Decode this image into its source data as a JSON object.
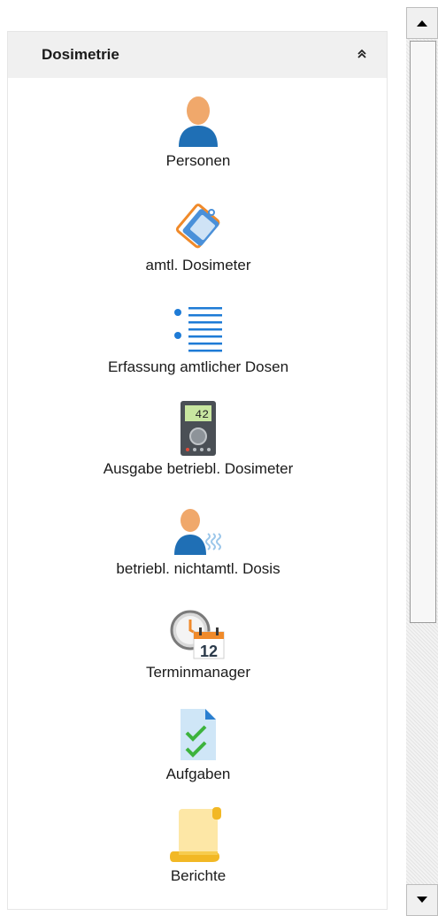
{
  "panel": {
    "title": "Dosimetrie",
    "collapse_icon": "double-chevron-up-icon"
  },
  "items": [
    {
      "label": "Personen",
      "icon": "person-icon"
    },
    {
      "label": "amtl. Dosimeter",
      "icon": "tag-icon"
    },
    {
      "label": "Erfassung amtlicher Dosen",
      "icon": "list-icon"
    },
    {
      "label": "Ausgabe betriebl. Dosimeter",
      "icon": "dosimeter-device-icon",
      "device_reading": "42"
    },
    {
      "label": "betriebl. nichtamtl. Dosis",
      "icon": "person-radiation-icon"
    },
    {
      "label": "Terminmanager",
      "icon": "clock-calendar-icon",
      "calendar_day": "12"
    },
    {
      "label": "Aufgaben",
      "icon": "checklist-document-icon"
    },
    {
      "label": "Berichte",
      "icon": "scroll-icon"
    }
  ],
  "scrollbar": {
    "up_icon": "scroll-up-arrow-icon",
    "down_icon": "scroll-down-arrow-icon"
  }
}
